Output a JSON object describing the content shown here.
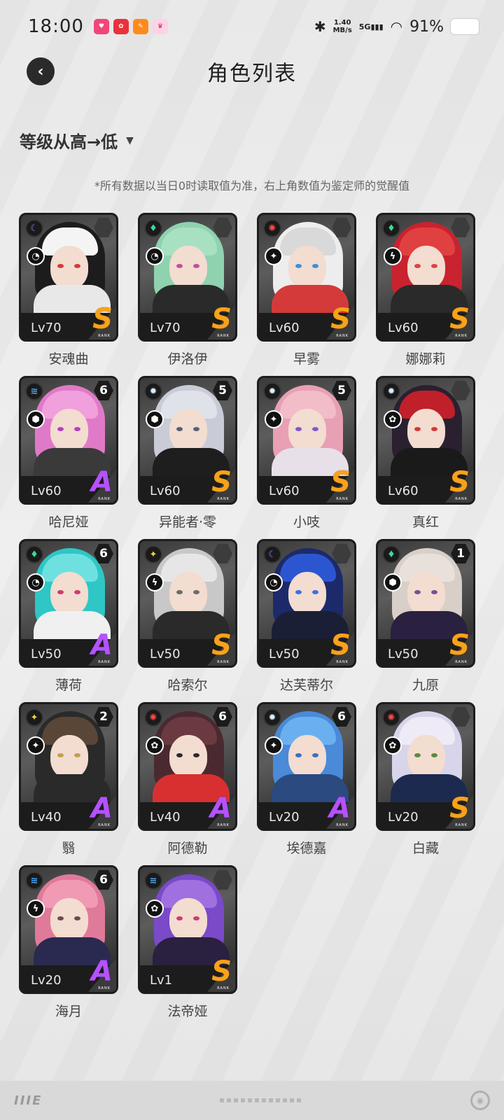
{
  "status_bar": {
    "time": "18:00",
    "apps": [
      "lofter-icon",
      "xiaohongshu-icon",
      "orange-app-icon",
      "crown-app-icon"
    ],
    "net_speed_value": "1.40",
    "net_speed_unit": "MB/s",
    "signal_label": "5G",
    "battery": "91%"
  },
  "header": {
    "title": "角色列表"
  },
  "sort": {
    "label": "等级从高→低"
  },
  "note": "*所有数据以当日0时读取值为准，右上角数值为鉴定师的觉醒值",
  "characters": [
    {
      "name": "安魂曲",
      "level": "Lv70",
      "rank": "S",
      "awaken": "",
      "elem_color": "#8a7cff",
      "elem": "☾",
      "type": "◔",
      "hair": "#1c1c1c",
      "hair2": "#f4f4f4",
      "eye": "#d23b3b",
      "body": "#e8e8e8"
    },
    {
      "name": "伊洛伊",
      "level": "Lv70",
      "rank": "S",
      "awaken": "",
      "elem_color": "#3fd6a0",
      "elem": "♦",
      "type": "◔",
      "hair": "#8fd2b0",
      "hair2": "#a8e0c2",
      "eye": "#c050a0",
      "body": "#2a2a2a"
    },
    {
      "name": "早雾",
      "level": "Lv60",
      "rank": "S",
      "awaken": "",
      "elem_color": "#ff4a4a",
      "elem": "✺",
      "type": "✦",
      "hair": "#ededed",
      "hair2": "#d9d9d9",
      "eye": "#3a8fe0",
      "body": "#d43a3a"
    },
    {
      "name": "娜娜莉",
      "level": "Lv60",
      "rank": "S",
      "awaken": "",
      "elem_color": "#3fd6a0",
      "elem": "♦",
      "type": "ϟ",
      "hair": "#c8232f",
      "hair2": "#e04040",
      "eye": "#d84545",
      "body": "#2a2a2a"
    },
    {
      "name": "哈尼娅",
      "level": "Lv60",
      "rank": "A",
      "awaken": "6",
      "elem_color": "#4aa8ff",
      "elem": "≋",
      "type": "⬢",
      "hair": "#e07ac8",
      "hair2": "#f0a0dc",
      "eye": "#b040c0",
      "body": "#3a3a3a"
    },
    {
      "name": "异能者·零",
      "level": "Lv60",
      "rank": "S",
      "awaken": "5",
      "elem_color": "#d8f0ff",
      "elem": "✹",
      "type": "⬢",
      "hair": "#c9ccd6",
      "hair2": "#e0e2ea",
      "eye": "#555f75",
      "body": "#1e1e1e"
    },
    {
      "name": "小吱",
      "level": "Lv60",
      "rank": "S",
      "awaken": "5",
      "elem_color": "#d8f0ff",
      "elem": "✹",
      "type": "✦",
      "hair": "#e8a0b4",
      "hair2": "#f2bcc8",
      "eye": "#7a5ad0",
      "body": "#e8e0e8"
    },
    {
      "name": "真红",
      "level": "Lv60",
      "rank": "S",
      "awaken": "",
      "elem_color": "#d8f0ff",
      "elem": "✹",
      "type": "✿",
      "hair": "#2a2030",
      "hair2": "#c0202a",
      "eye": "#d03a3a",
      "body": "#1a1a1a"
    },
    {
      "name": "薄荷",
      "level": "Lv50",
      "rank": "A",
      "awaken": "6",
      "elem_color": "#3fd6a0",
      "elem": "♦",
      "type": "◔",
      "hair": "#2fc6c6",
      "hair2": "#6ee0e0",
      "eye": "#d03a70",
      "body": "#f0f0f0"
    },
    {
      "name": "哈索尔",
      "level": "Lv50",
      "rank": "S",
      "awaken": "",
      "elem_color": "#f2d23a",
      "elem": "✦",
      "type": "ϟ",
      "hair": "#c8c8c8",
      "hair2": "#e6e6e6",
      "eye": "#6a6a6a",
      "body": "#2a2a2a"
    },
    {
      "name": "达芙蒂尔",
      "level": "Lv50",
      "rank": "S",
      "awaken": "",
      "elem_color": "#8a7cff",
      "elem": "☾",
      "type": "◔",
      "hair": "#1c2a6a",
      "hair2": "#2c56d0",
      "eye": "#3a70e0",
      "body": "#1a1f35"
    },
    {
      "name": "九原",
      "level": "Lv50",
      "rank": "S",
      "awaken": "1",
      "elem_color": "#3fd6a0",
      "elem": "♦",
      "type": "⬢",
      "hair": "#d8cfc8",
      "hair2": "#e8e0da",
      "eye": "#7a5090",
      "body": "#2a2040"
    },
    {
      "name": "翳",
      "level": "Lv40",
      "rank": "A",
      "awaken": "2",
      "elem_color": "#f2d23a",
      "elem": "✦",
      "type": "✦",
      "hair": "#2a2a2a",
      "hair2": "#5a4636",
      "eye": "#c0a050",
      "body": "#2a2a2a"
    },
    {
      "name": "阿德勒",
      "level": "Lv40",
      "rank": "A",
      "awaken": "6",
      "elem_color": "#ff4a4a",
      "elem": "✺",
      "type": "✿",
      "hair": "#4a2a30",
      "hair2": "#6a3a40",
      "eye": "#2a2a2a",
      "body": "#d83030"
    },
    {
      "name": "埃德嘉",
      "level": "Lv20",
      "rank": "A",
      "awaken": "6",
      "elem_color": "#d8f0ff",
      "elem": "✹",
      "type": "✦",
      "hair": "#4a8ad8",
      "hair2": "#6ab0f0",
      "eye": "#3a70c0",
      "body": "#2a4a80"
    },
    {
      "name": "白藏",
      "level": "Lv20",
      "rank": "S",
      "awaken": "",
      "elem_color": "#ff4a4a",
      "elem": "✺",
      "type": "✿",
      "hair": "#d8d4ea",
      "hair2": "#eeeaf6",
      "eye": "#5a8a3a",
      "body": "#1c2a50"
    },
    {
      "name": "海月",
      "level": "Lv20",
      "rank": "A",
      "awaken": "6",
      "elem_color": "#4aa8ff",
      "elem": "≋",
      "type": "ϟ",
      "hair": "#e07a9a",
      "hair2": "#f09ab4",
      "eye": "#6a4a50",
      "body": "#2a2a50"
    },
    {
      "name": "法帝娅",
      "level": "Lv1",
      "rank": "S",
      "awaken": "",
      "elem_color": "#4aa8ff",
      "elem": "≋",
      "type": "✿",
      "hair": "#7a4ac8",
      "hair2": "#a070e0",
      "eye": "#d03a70",
      "body": "#2a2040"
    }
  ],
  "footer": {
    "logo_text": "IIIE"
  }
}
